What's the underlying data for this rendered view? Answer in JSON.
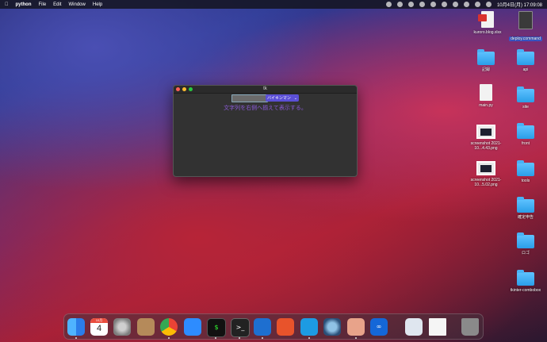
{
  "menubar": {
    "apple_icon": "apple-icon",
    "app_name": "python",
    "menus": [
      "File",
      "Edit",
      "Window",
      "Help"
    ],
    "clock": "10月4日(月)  17:09:08"
  },
  "window": {
    "title": "tk",
    "combobox_value": "バイキンマン",
    "label_text": "文字列を右側へ揃えて表示する。"
  },
  "desktop": {
    "items": [
      {
        "name": "kuroro.blog.xlsx",
        "kind": "doc-red"
      },
      {
        "name": "deploy.command",
        "kind": "doc-dark",
        "selected": true
      },
      {
        "name": "記録",
        "kind": "folder"
      },
      {
        "name": "api",
        "kind": "folder"
      },
      {
        "name": "main.py",
        "kind": "doc"
      },
      {
        "name": "site",
        "kind": "folder"
      },
      {
        "name": "screenshot 2021-10...4.43.png",
        "kind": "shot"
      },
      {
        "name": "front",
        "kind": "folder"
      },
      {
        "name": "screenshot 2021-10...5.02.png",
        "kind": "shot"
      },
      {
        "name": "tools",
        "kind": "folder"
      },
      {
        "name": "確定申告",
        "kind": "folder"
      },
      {
        "name": "ロゴ",
        "kind": "folder"
      },
      {
        "name": "tkinter-combobox",
        "kind": "folder"
      }
    ]
  },
  "dock": {
    "calendar_month": "10月",
    "calendar_day": "4"
  }
}
